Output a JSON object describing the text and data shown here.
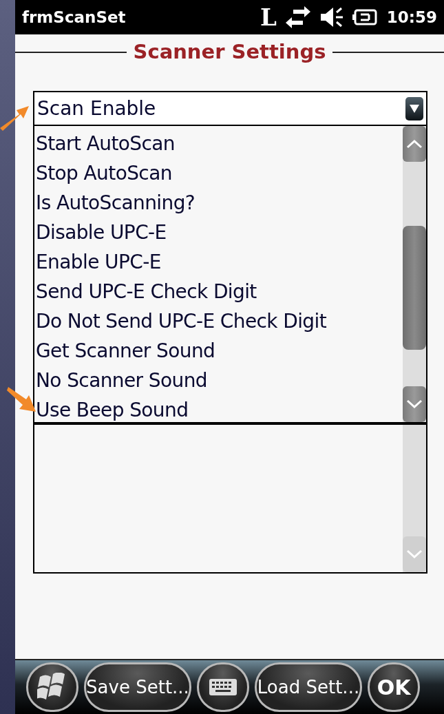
{
  "title_bar": {
    "title": "frmScanSet",
    "indicator": "L",
    "time": "10:59"
  },
  "heading": "Scanner Settings",
  "combo": {
    "value": "Scan Enable"
  },
  "dropdown_items": [
    "Start AutoScan",
    "Stop AutoScan",
    "Is AutoScanning?",
    "Disable UPC-E",
    "Enable UPC-E",
    "Send UPC-E Check Digit",
    "Do Not Send UPC-E Check Digit",
    "Get Scanner Sound",
    "No Scanner Sound",
    "Use Beep Sound"
  ],
  "soft_buttons": [
    {
      "kind": "start"
    },
    {
      "kind": "text",
      "label": "Save Sett..."
    },
    {
      "kind": "keyboard"
    },
    {
      "kind": "text",
      "label": "Load Sett..."
    },
    {
      "kind": "ok",
      "label": "OK"
    }
  ]
}
